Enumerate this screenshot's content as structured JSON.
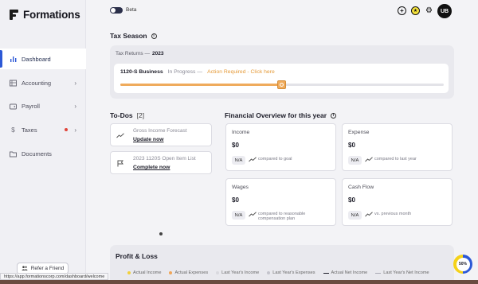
{
  "app": {
    "name": "Formations"
  },
  "sidebar": {
    "items": [
      {
        "label": "Dashboard",
        "icon": "bar-chart-icon",
        "active": true,
        "chevron": false
      },
      {
        "label": "Accounting",
        "icon": "ledger-icon",
        "active": false,
        "chevron": true
      },
      {
        "label": "Payroll",
        "icon": "wallet-icon",
        "active": false,
        "chevron": true
      },
      {
        "label": "Taxes",
        "icon": "dollar-icon",
        "active": false,
        "chevron": true,
        "alert": true
      },
      {
        "label": "Documents",
        "icon": "folder-icon",
        "active": false,
        "chevron": false
      }
    ],
    "refer_label": "Refer a Friend"
  },
  "status_url": "https://app.formationscorp.com/dashboard/welcome",
  "topbar": {
    "beta_label": "Beta",
    "beta_enabled": true,
    "avatar_initials": "UB"
  },
  "tax_season": {
    "title": "Tax Season",
    "returns_label": "Tax Returns —",
    "year": "2023",
    "business": "1120-S Business",
    "status": "In Progress —",
    "action": "Action Required - Click here",
    "progress": 0.5
  },
  "todos": {
    "title": "To-Dos",
    "count": "[2]",
    "items": [
      {
        "title": "Gross Income Forecast",
        "action": "Update now",
        "icon": "trend-icon"
      },
      {
        "title": "2023 1120S Open Item List",
        "action": "Complete now",
        "icon": "flag-icon"
      }
    ]
  },
  "financial": {
    "title": "Financial Overview for this year",
    "cards": [
      {
        "label": "Income",
        "value": "$0",
        "badge": "N/A",
        "compare": "compared to goal"
      },
      {
        "label": "Expense",
        "value": "$0",
        "badge": "N/A",
        "compare": "compared to last year"
      },
      {
        "label": "Wages",
        "value": "$0",
        "badge": "N/A",
        "compare": "compared to reasonable compensation plan"
      },
      {
        "label": "Cash Flow",
        "value": "$0",
        "badge": "N/A",
        "compare": "vs. previous month"
      }
    ]
  },
  "profit_loss": {
    "title": "Profit & Loss",
    "legend": [
      {
        "label": "Actual Income",
        "color": "#f2d03a",
        "type": "dot"
      },
      {
        "label": "Actual Expenses",
        "color": "#f0a65a",
        "type": "dot"
      },
      {
        "label": "Last Year's Income",
        "color": "#d9d9de",
        "type": "dot"
      },
      {
        "label": "Last Year's Expenses",
        "color": "#c4c4cc",
        "type": "dot"
      },
      {
        "label": "Actual Net Income",
        "color": "#1c1c28",
        "type": "line"
      },
      {
        "label": "Last Year's Net Income",
        "color": "#a9a9b3",
        "type": "line"
      }
    ]
  },
  "completion": {
    "label": "50%",
    "value": 0.5
  }
}
